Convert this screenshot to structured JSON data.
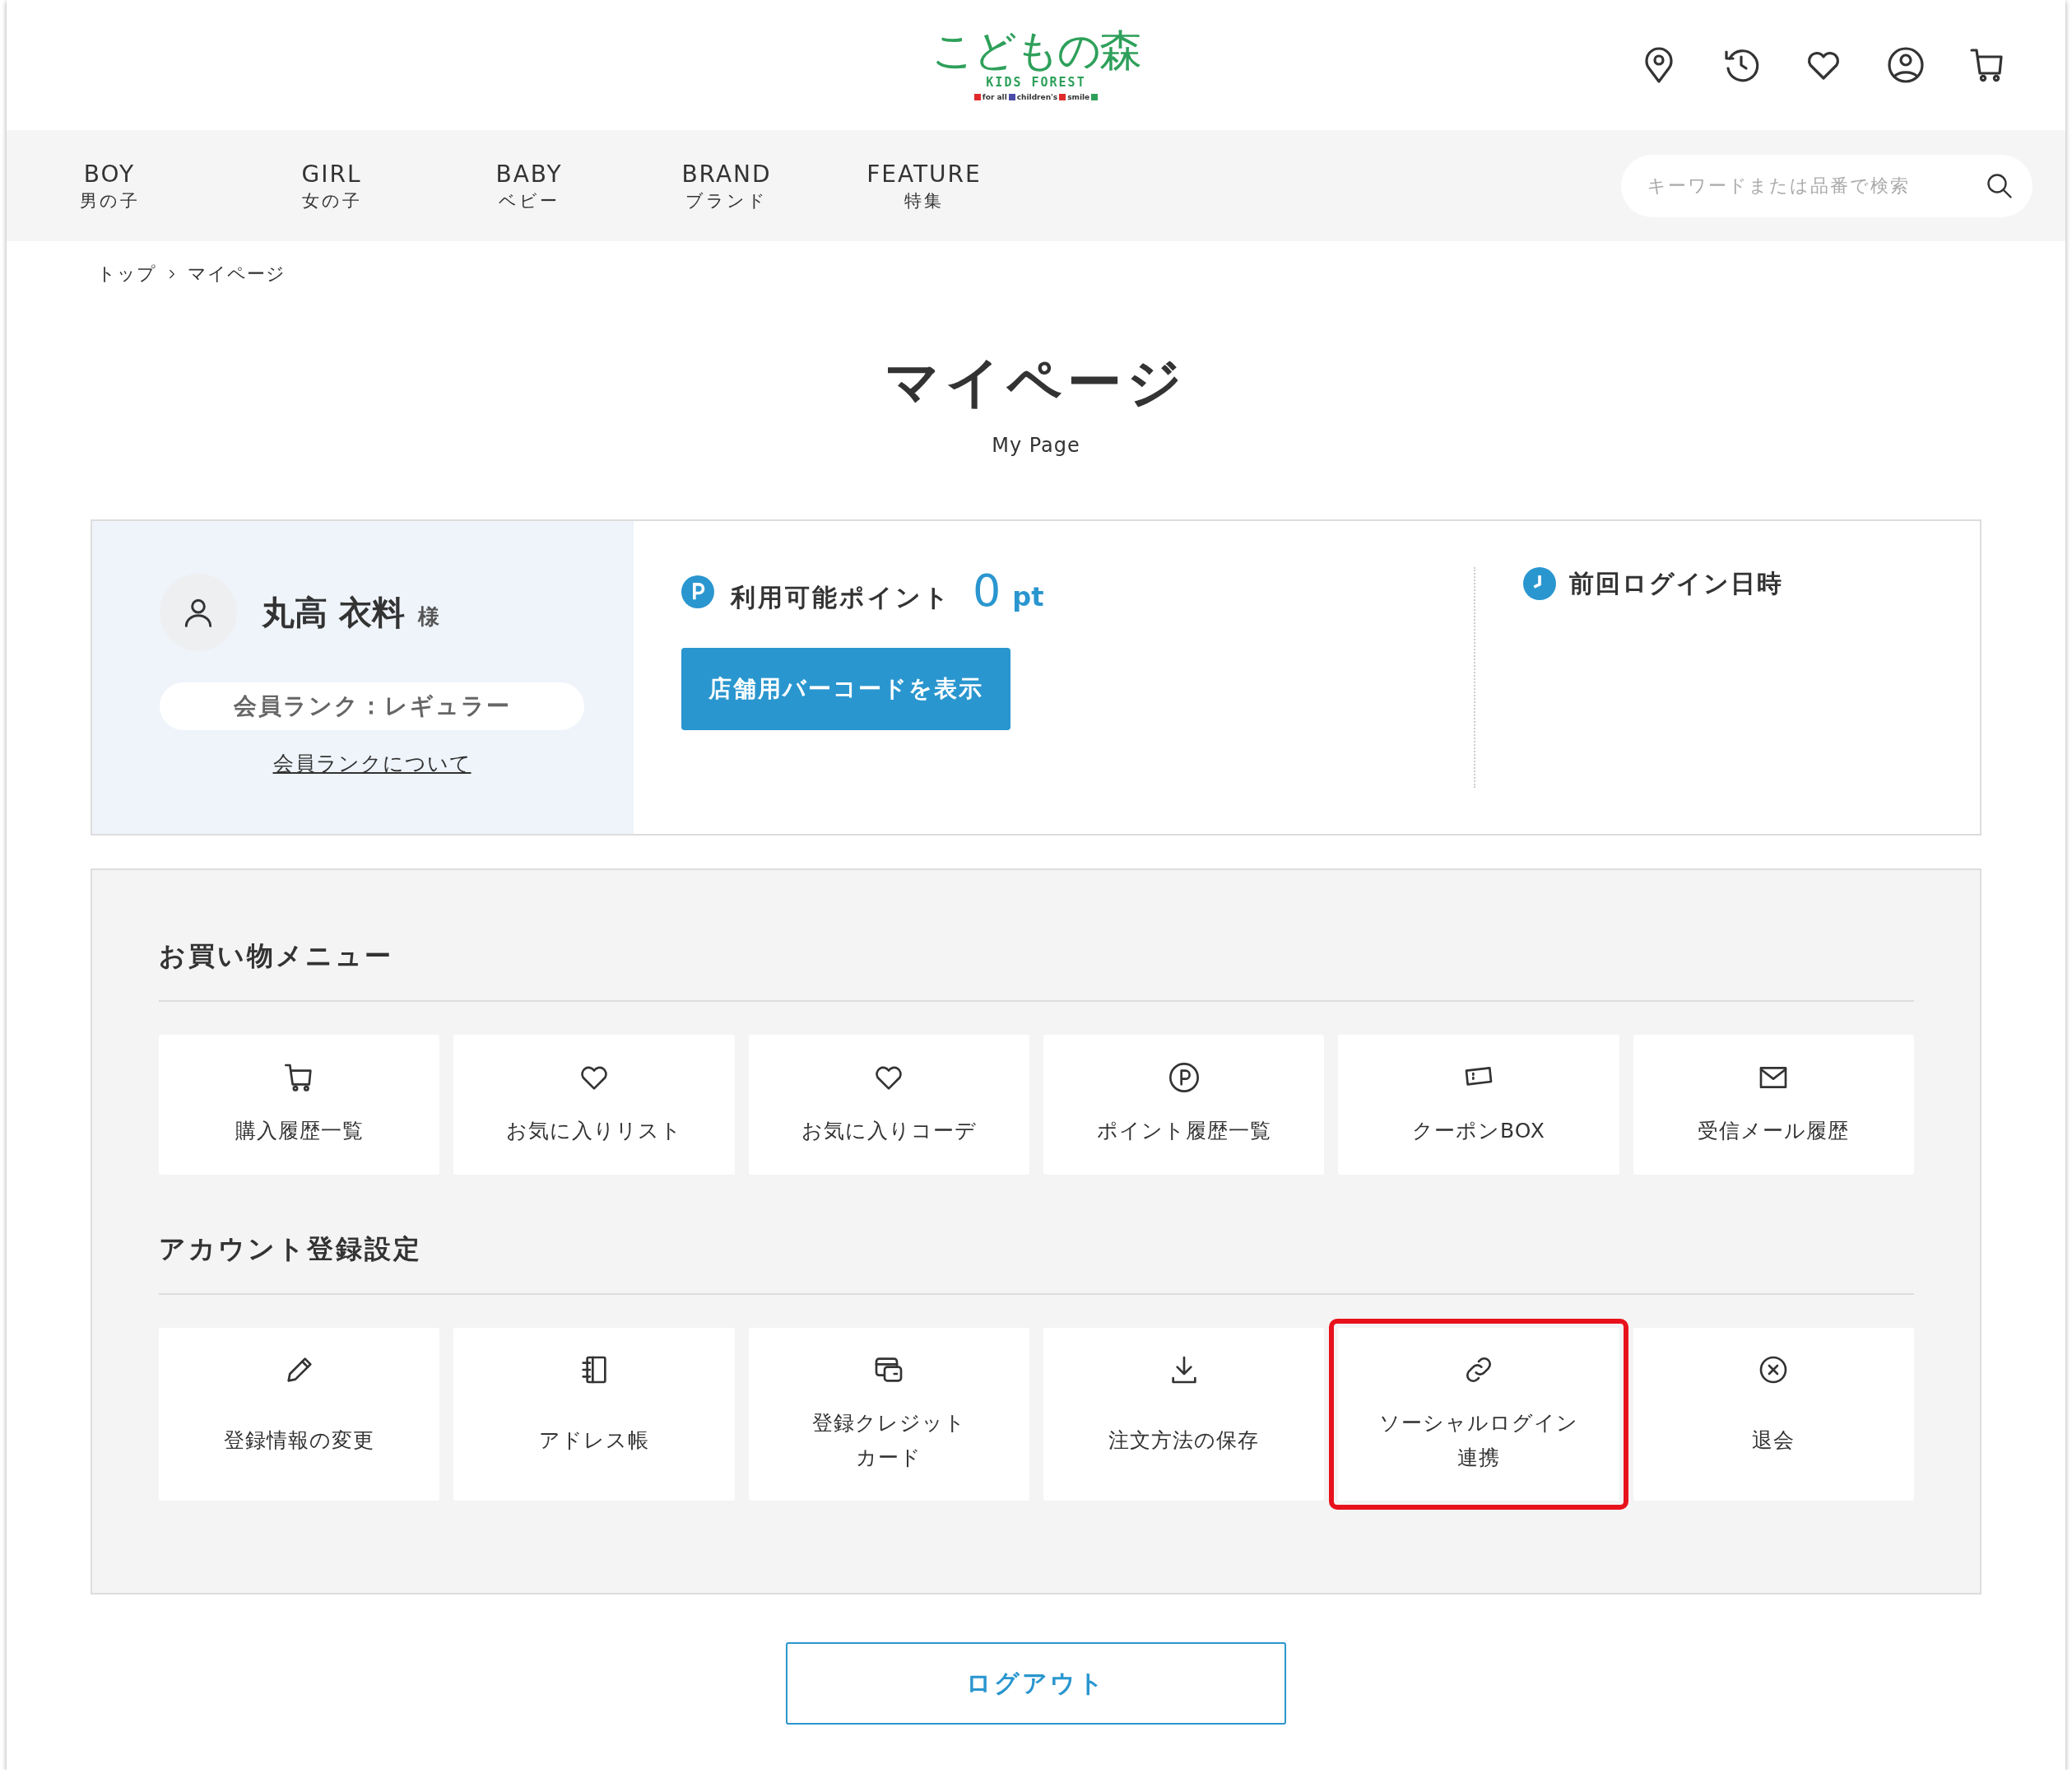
{
  "header": {
    "logo": {
      "title": "こどもの森",
      "subtitle": "KIDS FOREST",
      "tagline": [
        "for all",
        "children's",
        "smile"
      ]
    }
  },
  "nav": {
    "items": [
      {
        "en": "BOY",
        "ja": "男の子"
      },
      {
        "en": "GIRL",
        "ja": "女の子"
      },
      {
        "en": "BABY",
        "ja": "ベビー"
      },
      {
        "en": "BRAND",
        "ja": "ブランド"
      },
      {
        "en": "FEATURE",
        "ja": "特集"
      }
    ],
    "search": {
      "placeholder": "キーワードまたは品番で検索"
    }
  },
  "breadcrumb": [
    "トップ",
    "マイページ"
  ],
  "page_title": "マイページ",
  "page_subtitle": "My Page",
  "profile": {
    "name": "丸高 衣料",
    "honorific": "様",
    "rank": "会員ランク：レギュラー",
    "rank_link": "会員ランクについて"
  },
  "points": {
    "label": "利用可能ポイント",
    "value": "0",
    "unit": "pt",
    "button": "店舗用バーコードを表示"
  },
  "last_login": {
    "label": "前回ログイン日時"
  },
  "sections": [
    {
      "title": "お買い物メニュー",
      "items": [
        {
          "label": "購入履歴一覧",
          "highlighted": false
        },
        {
          "label": "お気に入りリスト",
          "highlighted": false
        },
        {
          "label": "お気に入りコーデ",
          "highlighted": false
        },
        {
          "label": "ポイント履歴一覧",
          "highlighted": false
        },
        {
          "label": "クーポンBOX",
          "highlighted": false
        },
        {
          "label": "受信メール履歴",
          "highlighted": false
        }
      ]
    },
    {
      "title": "アカウント登録設定",
      "items": [
        {
          "label": "登録情報の変更",
          "highlighted": false
        },
        {
          "label": "アドレス帳",
          "highlighted": false
        },
        {
          "label": [
            "登録クレジット",
            "カード"
          ],
          "highlighted": false
        },
        {
          "label": "注文方法の保存",
          "highlighted": false
        },
        {
          "label": [
            "ソーシャルログイン",
            "連携"
          ],
          "highlighted": true
        },
        {
          "label": "退会",
          "highlighted": false
        }
      ]
    }
  ],
  "logout": "ログアウト"
}
